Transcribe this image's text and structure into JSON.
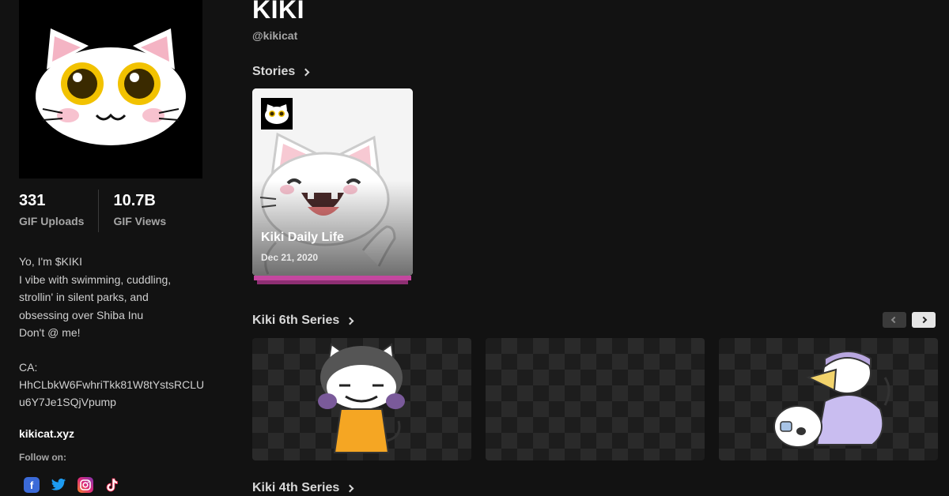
{
  "profile": {
    "name": "KIKI",
    "handle": "@kikicat"
  },
  "stats": {
    "uploads_value": "331",
    "uploads_label": "GIF Uploads",
    "views_value": "10.7B",
    "views_label": "GIF Views"
  },
  "bio": {
    "lines": [
      "Yo, I'm $KIKI",
      "I vibe with swimming, cuddling,",
      "strollin' in silent parks, and",
      "obsessing over Shiba Inu",
      "Don't @ me!"
    ],
    "ca_label": "CA:",
    "ca_value": "HhCLbkW6FwhriTkk81W8tYstsRCLUu6Y7Je1SQjVpump"
  },
  "website": "kikicat.xyz",
  "follow_label": "Follow on:",
  "socials": [
    {
      "name": "facebook",
      "icon": "facebook-icon",
      "glyph": "f",
      "color": "#3b6ad8"
    },
    {
      "name": "twitter",
      "icon": "twitter-icon",
      "glyph": "🐦",
      "color": "#1d9bf0"
    },
    {
      "name": "instagram",
      "icon": "instagram-icon",
      "glyph": "◎",
      "color": "#dd2a7b"
    },
    {
      "name": "tiktok",
      "icon": "tiktok-icon",
      "glyph": "♪",
      "color": "#ffffff"
    }
  ],
  "sections": {
    "stories": "Stories",
    "series6": "Kiki 6th Series",
    "series4": "Kiki 4th Series"
  },
  "story": {
    "title": "Kiki Daily Life",
    "date": "Dec 21, 2020"
  },
  "colors": {
    "background": "#121212",
    "story_accent": "#c4479f"
  }
}
